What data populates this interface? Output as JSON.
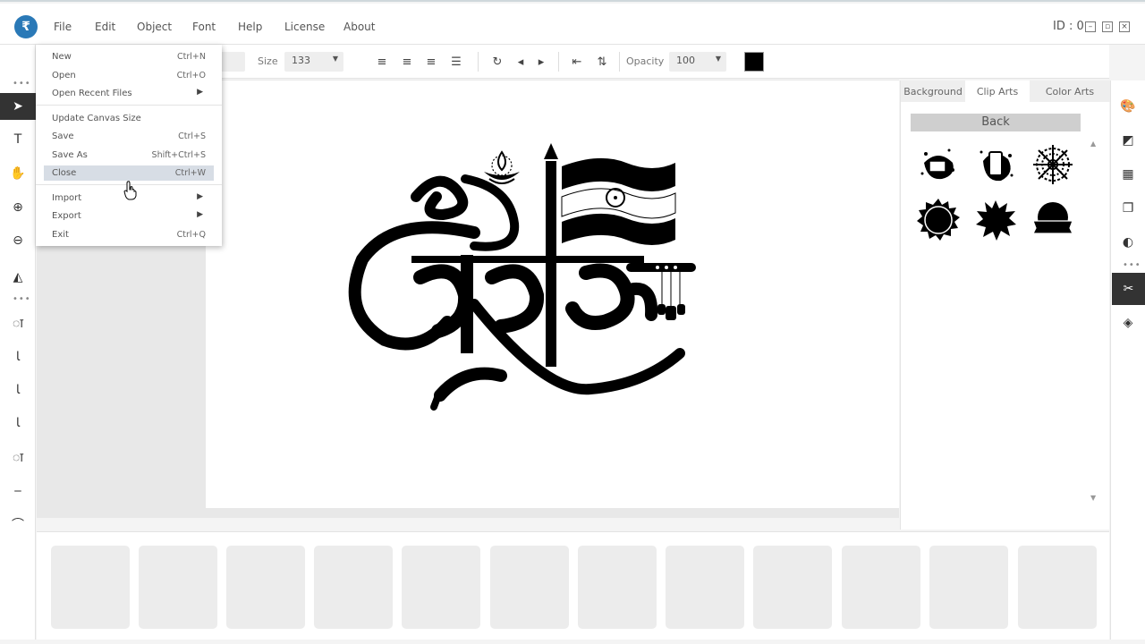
{
  "app": {
    "logo": "₹"
  },
  "menu": {
    "items": [
      "File",
      "Edit",
      "Object",
      "Font",
      "Help",
      "License",
      "About"
    ],
    "id_label": "ID : 0"
  },
  "toolbar": {
    "size_label": "Size",
    "size_value": "133",
    "opacity_label": "Opacity",
    "opacity_value": "100",
    "fill_color": "#000000"
  },
  "file_menu": {
    "items": [
      {
        "label": "New",
        "shortcut": "Ctrl+N"
      },
      {
        "label": "Open",
        "shortcut": "Ctrl+O"
      },
      {
        "label": "Open Recent Files",
        "shortcut": ""
      },
      {
        "label": "Update Canvas Size",
        "shortcut": ""
      },
      {
        "label": "Save",
        "shortcut": "Ctrl+S"
      },
      {
        "label": "Save As",
        "shortcut": "Shift+Ctrl+S"
      },
      {
        "label": "Close",
        "shortcut": "Ctrl+W"
      },
      {
        "label": "Import",
        "shortcut": ""
      },
      {
        "label": "Export",
        "shortcut": ""
      },
      {
        "label": "Exit",
        "shortcut": "Ctrl+Q"
      }
    ],
    "highlighted": "Close"
  },
  "panel": {
    "tabs": [
      "Background",
      "Clip Arts",
      "Color Arts"
    ],
    "active_tab": "Clip Arts",
    "back_label": "Back",
    "clip_arts": [
      "ink-splash-frame",
      "ink-splash-phone",
      "floral-mandala",
      "sun-badge",
      "ink-blot",
      "ribbon-badge"
    ]
  },
  "colors": {
    "accent": "#2a79b7",
    "dark": "#333333",
    "thumb": "#ececec"
  }
}
